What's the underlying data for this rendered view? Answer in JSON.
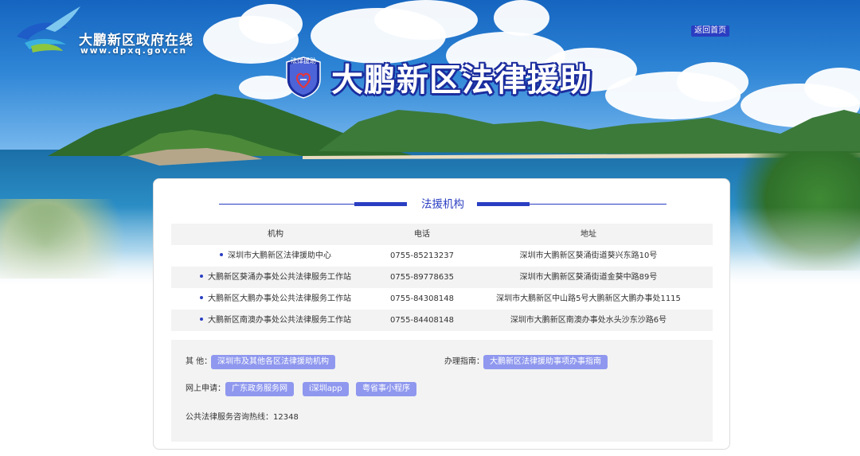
{
  "header": {
    "site_name": "大鹏新区政府在线",
    "site_url": "www.dpxq.gov.cn",
    "home_link": "返回首页",
    "badge_text": "法律援助",
    "page_title": "大鹏新区法律援助"
  },
  "section": {
    "title": "法援机构"
  },
  "table": {
    "columns": [
      "机构",
      "电话",
      "地址"
    ],
    "rows": [
      {
        "org": "深圳市大鹏新区法律援助中心",
        "tel": "0755-85213237",
        "addr": "深圳市大鹏新区葵涌街道葵兴东路10号"
      },
      {
        "org": "大鹏新区葵涌办事处公共法律服务工作站",
        "tel": "0755-89778635",
        "addr": "深圳市大鹏新区葵涌街道金葵中路89号"
      },
      {
        "org": "大鹏新区大鹏办事处公共法律服务工作站",
        "tel": "0755-84308148",
        "addr": "深圳市大鹏新区中山路5号大鹏新区大鹏办事处1115"
      },
      {
        "org": "大鹏新区南澳办事处公共法律服务工作站",
        "tel": "0755-84408148",
        "addr": "深圳市大鹏新区南澳办事处水头沙东沙路6号"
      }
    ]
  },
  "info": {
    "other_label": "其 他：",
    "other_link": "深圳市及其他各区法律援助机构",
    "guide_label": "办理指南：",
    "guide_link": "大鹏新区法律援助事项办事指南",
    "apply_label": "网上申请：",
    "apply_links": [
      "广东政务服务网",
      "i深圳app",
      "粤省事小程序"
    ],
    "hotline": "公共法律服务咨询热线：12348"
  },
  "colors": {
    "accent": "#2a3ec2",
    "pill": "#8f98ee",
    "row_alt": "#f3f3f3"
  }
}
